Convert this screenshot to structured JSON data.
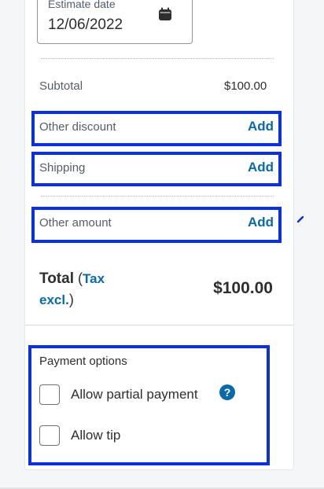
{
  "estimate_date": {
    "label": "Estimate date",
    "value": "12/06/2022",
    "icon": "calendar-icon"
  },
  "subtotal": {
    "label": "Subtotal",
    "value": "$100.00"
  },
  "other_discount": {
    "label": "Other discount",
    "action": "Add"
  },
  "shipping": {
    "label": "Shipping",
    "action": "Add"
  },
  "other_amount": {
    "label": "Other amount",
    "action": "Add"
  },
  "total": {
    "label": "Total",
    "open_paren": "(",
    "tax_link": "Tax excl.",
    "close_paren": ")",
    "value": "$100.00"
  },
  "payment_options": {
    "title": "Payment options",
    "options": [
      {
        "label": "Allow partial payment",
        "checked": false
      },
      {
        "label": "Allow tip",
        "checked": false
      }
    ],
    "help_icon": "?"
  },
  "colors": {
    "accent_link": "#0a6aa8",
    "highlight_border": "#0b30e0"
  }
}
